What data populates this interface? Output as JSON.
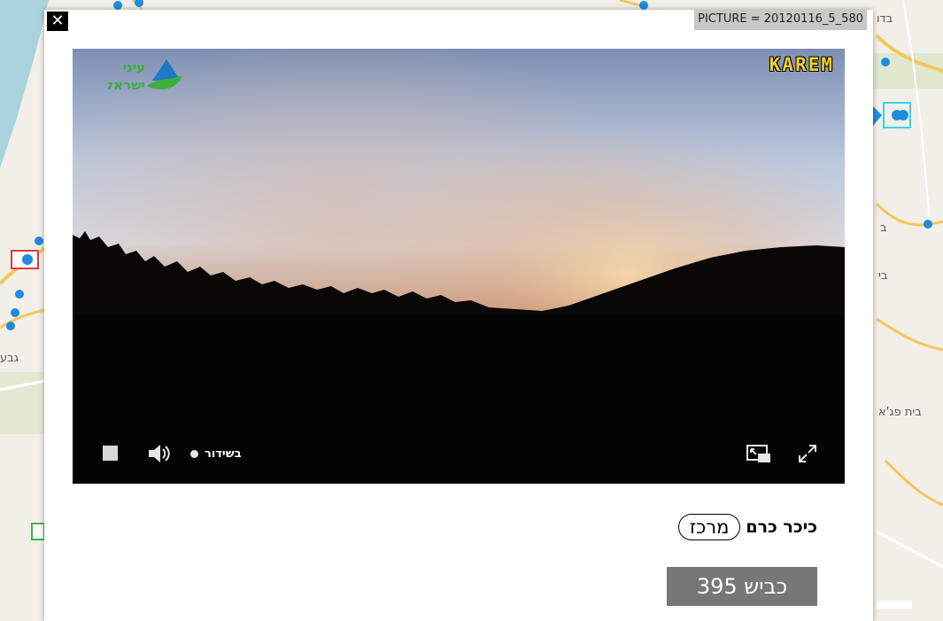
{
  "modal": {
    "close_label": "✕",
    "picture_id": "PICTURE = 20120116_5_580"
  },
  "video": {
    "brand_logo_text": "עיני ישראל",
    "brand_text": "KAREM",
    "live_label": "בשידור",
    "controls": [
      "stop-icon",
      "volume-icon",
      "picture-in-picture-icon",
      "fullscreen-icon"
    ]
  },
  "info": {
    "location_name": "כיכר כרם",
    "region": "מרכז",
    "road": "כביש 395"
  },
  "map": {
    "labels": [
      "בדו",
      "בית פג'א",
      "גבע",
      "בי",
      "ב"
    ]
  },
  "colors": {
    "road_badge": "#777777",
    "brand_yellow": "#f6d21a",
    "marker_blue": "#1f8ce0",
    "map_road": "#f5c65a"
  }
}
